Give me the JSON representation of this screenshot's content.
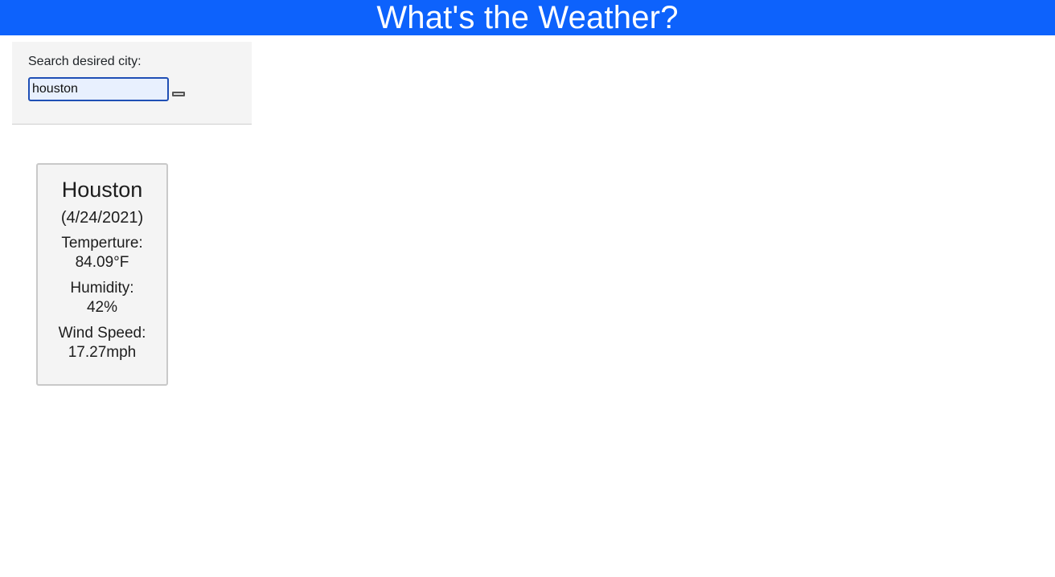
{
  "header": {
    "title": "What's the Weather?"
  },
  "search": {
    "label": "Search desired city:",
    "value": "houston",
    "button_label": ""
  },
  "weather": {
    "city": "Houston",
    "date": "(4/24/2021)",
    "temperature_label": "Temperture:",
    "temperature_value": "84.09°F",
    "humidity_label": "Humidity:",
    "humidity_value": "42%",
    "wind_label": "Wind Speed:",
    "wind_value": "17.27mph"
  },
  "colors": {
    "header_bg": "#0d62fc",
    "panel_bg": "#f4f4f4",
    "input_border": "#1f4fb5",
    "input_bg": "#e8f0fe"
  }
}
